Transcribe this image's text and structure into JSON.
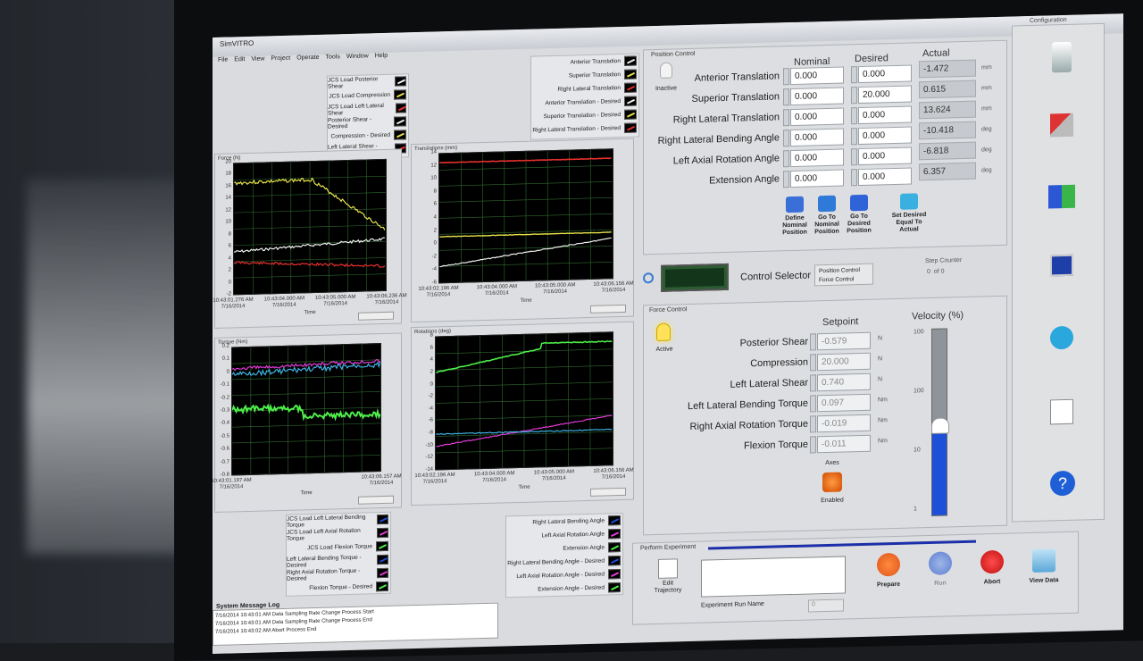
{
  "window": {
    "title": "SimVITRO",
    "menus": [
      "File",
      "Edit",
      "View",
      "Project",
      "Operate",
      "Tools",
      "Window",
      "Help"
    ]
  },
  "colors": {
    "yellow": "#e9e34b",
    "white": "#f2f2f2",
    "red": "#e8302e",
    "magenta": "#e23bd6",
    "cyan": "#3fb5e6",
    "green": "#4ef04a",
    "blue": "#1d4fd8"
  },
  "force_legend": [
    "JCS Load Posterior Shear",
    "JCS Load Compression",
    "JCS Load Left Lateral Shear",
    "Posterior Shear - Desired",
    "Compression - Desired",
    "Left Lateral Shear - Desired"
  ],
  "trans_legend": [
    "Anterior Translation",
    "Superior Translation",
    "Right Lateral Translation",
    "Anterior Translation - Desired",
    "Superior Translation - Desired",
    "Right Lateral Translation - Desired"
  ],
  "torque_legend": [
    "JCS Load Left Lateral Bending Torque",
    "JCS Load Left Axial Rotation Torque",
    "JCS Load Flexion Torque",
    "Left Lateral Bending Torque - Desired",
    "Right Axial Rotation Torque - Desired",
    "Flexion Torque - Desired"
  ],
  "rot_legend": [
    "Right Lateral Bending Angle",
    "Left Axial Rotation Angle",
    "Extension Angle",
    "Right Lateral Bending Angle - Desired",
    "Left Axial Rotation Angle - Desired",
    "Extension Angle - Desired"
  ],
  "force_chart": {
    "label": "Force (N)",
    "yticks": [
      "20",
      "18",
      "16",
      "14",
      "12",
      "10",
      "8",
      "6",
      "4",
      "2",
      "0",
      "-2"
    ],
    "xticks": [
      "10:43:01.276 AM\n7/16/2014",
      "10:43:04.000 AM\n7/16/2014",
      "10:43:05.000 AM\n7/16/2014",
      "10:43:06.236 AM\n7/16/2014"
    ],
    "xlabel": "Time"
  },
  "trans_chart": {
    "label": "Translations (mm)",
    "yticks": [
      "14",
      "12",
      "10",
      "8",
      "6",
      "4",
      "2",
      "0",
      "-2",
      "-4",
      "-6"
    ],
    "xticks": [
      "10:43:02.196 AM\n7/16/2014",
      "10:43:04.000 AM\n7/16/2014",
      "10:43:05.000 AM\n7/16/2014",
      "10:43:06.156 AM\n7/16/2014"
    ],
    "xlabel": "Time"
  },
  "torque_chart": {
    "label": "Torque (Nm)",
    "yticks": [
      "0.2",
      "0.1",
      "0",
      "-0.1",
      "-0.2",
      "-0.3",
      "-0.4",
      "-0.5",
      "-0.6",
      "-0.7",
      "-0.8"
    ],
    "xticks": [
      "10:43:01.197 AM\n7/16/2014",
      "10:43:06.157 AM\n7/16/2014"
    ],
    "xlabel": "Time"
  },
  "rot_chart": {
    "label": "Rotations (deg)",
    "yticks": [
      "8",
      "6",
      "4",
      "2",
      "0",
      "-2",
      "-4",
      "-6",
      "-8",
      "-10",
      "-12",
      "-14"
    ],
    "xticks": [
      "10:43:02.196 AM\n7/16/2014",
      "10:43:04.000 AM\n7/16/2014",
      "10:43:05.000 AM\n7/16/2014",
      "10:43:06.156 AM\n7/16/2014"
    ],
    "xlabel": "Time"
  },
  "position_control": {
    "title": "Position Control",
    "status": "Inactive",
    "headers": {
      "nominal": "Nominal",
      "desired": "Desired",
      "actual": "Actual"
    },
    "rows": [
      {
        "label": "Anterior Translation",
        "nominal": "0.000",
        "desired": "0.000",
        "actual": "-1.472",
        "unit": "mm"
      },
      {
        "label": "Superior Translation",
        "nominal": "0.000",
        "desired": "20.000",
        "actual": "0.615",
        "unit": "mm"
      },
      {
        "label": "Right Lateral Translation",
        "nominal": "0.000",
        "desired": "0.000",
        "actual": "13.624",
        "unit": "mm"
      },
      {
        "label": "Right Lateral Bending Angle",
        "nominal": "0.000",
        "desired": "0.000",
        "actual": "-10.418",
        "unit": "deg"
      },
      {
        "label": "Left Axial Rotation Angle",
        "nominal": "0.000",
        "desired": "0.000",
        "actual": "-6.818",
        "unit": "deg"
      },
      {
        "label": "Extension Angle",
        "nominal": "0.000",
        "desired": "0.000",
        "actual": "6.357",
        "unit": "deg"
      }
    ],
    "buttons": [
      "Define Nominal Position",
      "Go To Nominal Position",
      "Go To Desired Position",
      "Set Desired Equal To Actual"
    ]
  },
  "control_selector": {
    "label": "Control Selector",
    "options": [
      "Position Control",
      "Force Control"
    ],
    "step_counter_label": "Step Counter",
    "step_value": "0",
    "step_of": "of 0"
  },
  "force_control": {
    "title": "Force Control",
    "status": "Active",
    "setpoint_header": "Setpoint",
    "velocity_header": "Velocity (%)",
    "axes_label": "Axes",
    "axes_status": "Enabled",
    "rows": [
      {
        "label": "Posterior Shear",
        "value": "-0.579",
        "unit": "N"
      },
      {
        "label": "Compression",
        "value": "20.000",
        "unit": "N"
      },
      {
        "label": "Left Lateral Shear",
        "value": "0.740",
        "unit": "N"
      },
      {
        "label": "Left Lateral Bending Torque",
        "value": "0.097",
        "unit": "Nm"
      },
      {
        "label": "Right Axial Rotation Torque",
        "value": "-0.019",
        "unit": "Nm"
      },
      {
        "label": "Flexion Torque",
        "value": "-0.011",
        "unit": "Nm"
      }
    ],
    "velocity_ticks": [
      "100",
      "100",
      "10",
      "1"
    ],
    "velocity_level": 0.48
  },
  "experiment": {
    "title": "Perform Experiment",
    "edit_label": "Edit Trajectory",
    "run_name_label": "Experiment Run Name",
    "run_count": "0",
    "buttons": [
      "Prepare",
      "Run",
      "Abort",
      "View Data"
    ]
  },
  "log": {
    "title": "System Message Log",
    "entries": [
      "7/16/2014 10:43:01 AM   Data Sampling Rate Change Process Start",
      "7/16/2014 10:43:01 AM   Data Sampling Rate Change Process End",
      "7/16/2014 10:43:02 AM   Abort Process End"
    ]
  },
  "sidebar": {
    "title": "Configuration"
  }
}
